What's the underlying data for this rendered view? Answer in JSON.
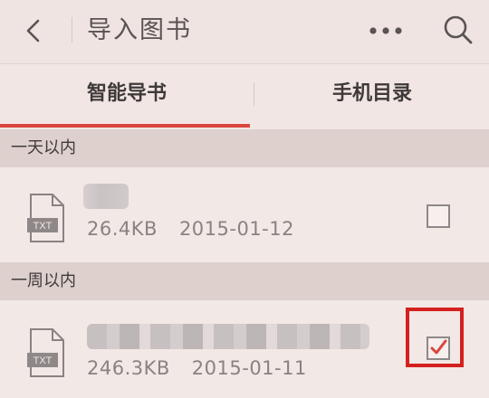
{
  "header": {
    "title": "导入图书",
    "back_icon": "chevron-left-icon",
    "more_icon": "more-horizontal-icon",
    "search_icon": "search-icon"
  },
  "tabs": [
    {
      "label": "智能导书",
      "active": true
    },
    {
      "label": "手机目录",
      "active": false
    }
  ],
  "sections": [
    {
      "title": "一天以内",
      "files": [
        {
          "type_label": "TXT",
          "size": "26.4KB",
          "date": "2015-01-12",
          "checked": false
        }
      ]
    },
    {
      "title": "一周以内",
      "files": [
        {
          "type_label": "TXT",
          "size": "246.3KB",
          "date": "2015-01-11",
          "checked": true
        }
      ]
    }
  ],
  "colors": {
    "accent": "#d9463e",
    "highlight_border": "#d4201e",
    "background": "#f1e6e3",
    "section_bg": "#ddd0cd"
  }
}
